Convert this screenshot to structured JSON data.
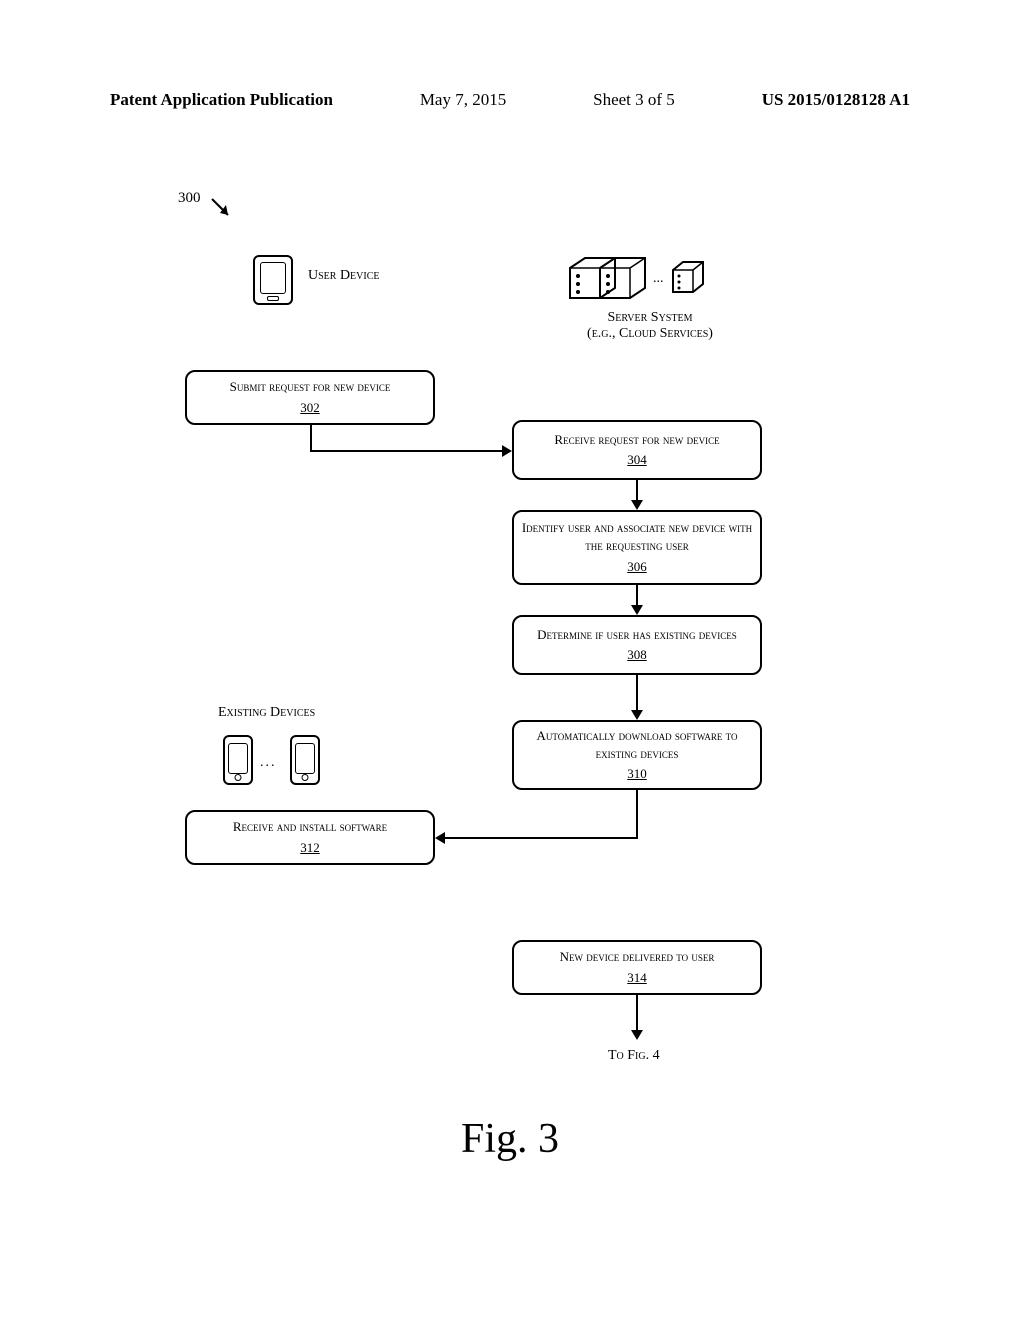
{
  "header": {
    "publication": "Patent Application Publication",
    "date": "May 7, 2015",
    "sheet": "Sheet 3 of 5",
    "number": "US 2015/0128128 A1"
  },
  "figure": {
    "number_label": "300",
    "user_device_label": "User Device",
    "server_label_1": "Server System",
    "server_label_2": "(e.g., Cloud Services)",
    "existing_label": "Existing Devices",
    "boxes": {
      "b302": {
        "text": "Submit request for new device",
        "ref": "302"
      },
      "b304": {
        "text": "Receive request for new device",
        "ref": "304"
      },
      "b306": {
        "text": "Identify user and associate new device with the requesting user",
        "ref": "306"
      },
      "b308": {
        "text": "Determine if user has existing devices",
        "ref": "308"
      },
      "b310": {
        "text": "Automatically download software to existing devices",
        "ref": "310"
      },
      "b312": {
        "text": "Receive and install software",
        "ref": "312"
      },
      "b314": {
        "text": "New device delivered to user",
        "ref": "314"
      }
    },
    "to_next": "To Fig. 4",
    "caption": "Fig. 3"
  },
  "ellipsis": "..."
}
